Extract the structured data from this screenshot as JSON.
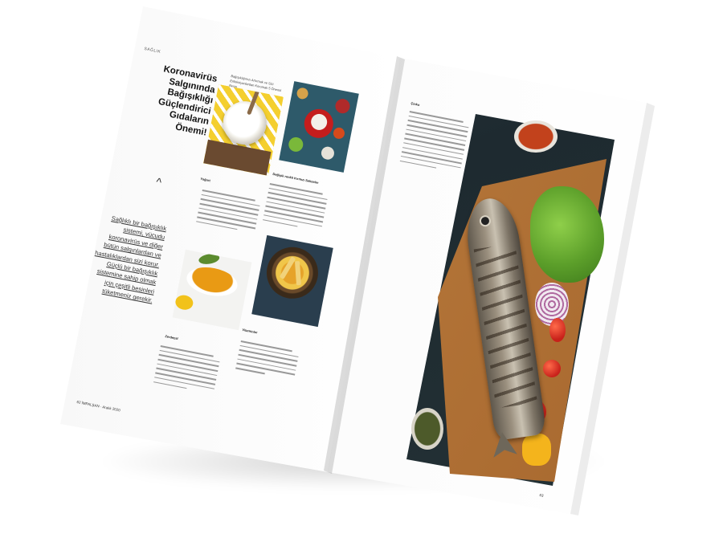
{
  "magazine": {
    "left_page": {
      "section_tag": "SAĞLIK",
      "headline_lines": [
        "Koronavirüs",
        "Salgınında",
        "Bağışıklığı",
        "Güçlendirici",
        "Gıdaların",
        "Önemi!"
      ],
      "caret_symbol": "^",
      "pullquote_lines": [
        "Sağlıklı bir bağışıklık",
        "sistemi, vücudu",
        "koronavirüs ve diğer",
        "bütün salgınlardan ve",
        "hastalıklardan sizi korur.",
        "Güçlü bir bağışıklık",
        "sistemine sahip olmak",
        "için çeşitli besinleri",
        "tüketmeniz gerekir."
      ],
      "intro_small_lines": [
        "Bağışıklığınızı Artırmak ve Sizi",
        "Enfeksiyonlardan Korumak 5 Önemli",
        "Besin"
      ],
      "captions": {
        "yogurt": "Yoğurt",
        "vegetables": "Değişik renkli Kırmızı Sebzeler",
        "turmeric": "Zerdeçal",
        "vitamins": "Vitaminler"
      },
      "folio": "62   İMPALŞAN · Aralık 2020"
    },
    "right_page": {
      "caption_fish": "Çinko",
      "folio": "63"
    }
  },
  "colors": {
    "headline": "#111111",
    "turmeric": "#e99a14",
    "yogurt_cloth": "#f4cf2f"
  }
}
